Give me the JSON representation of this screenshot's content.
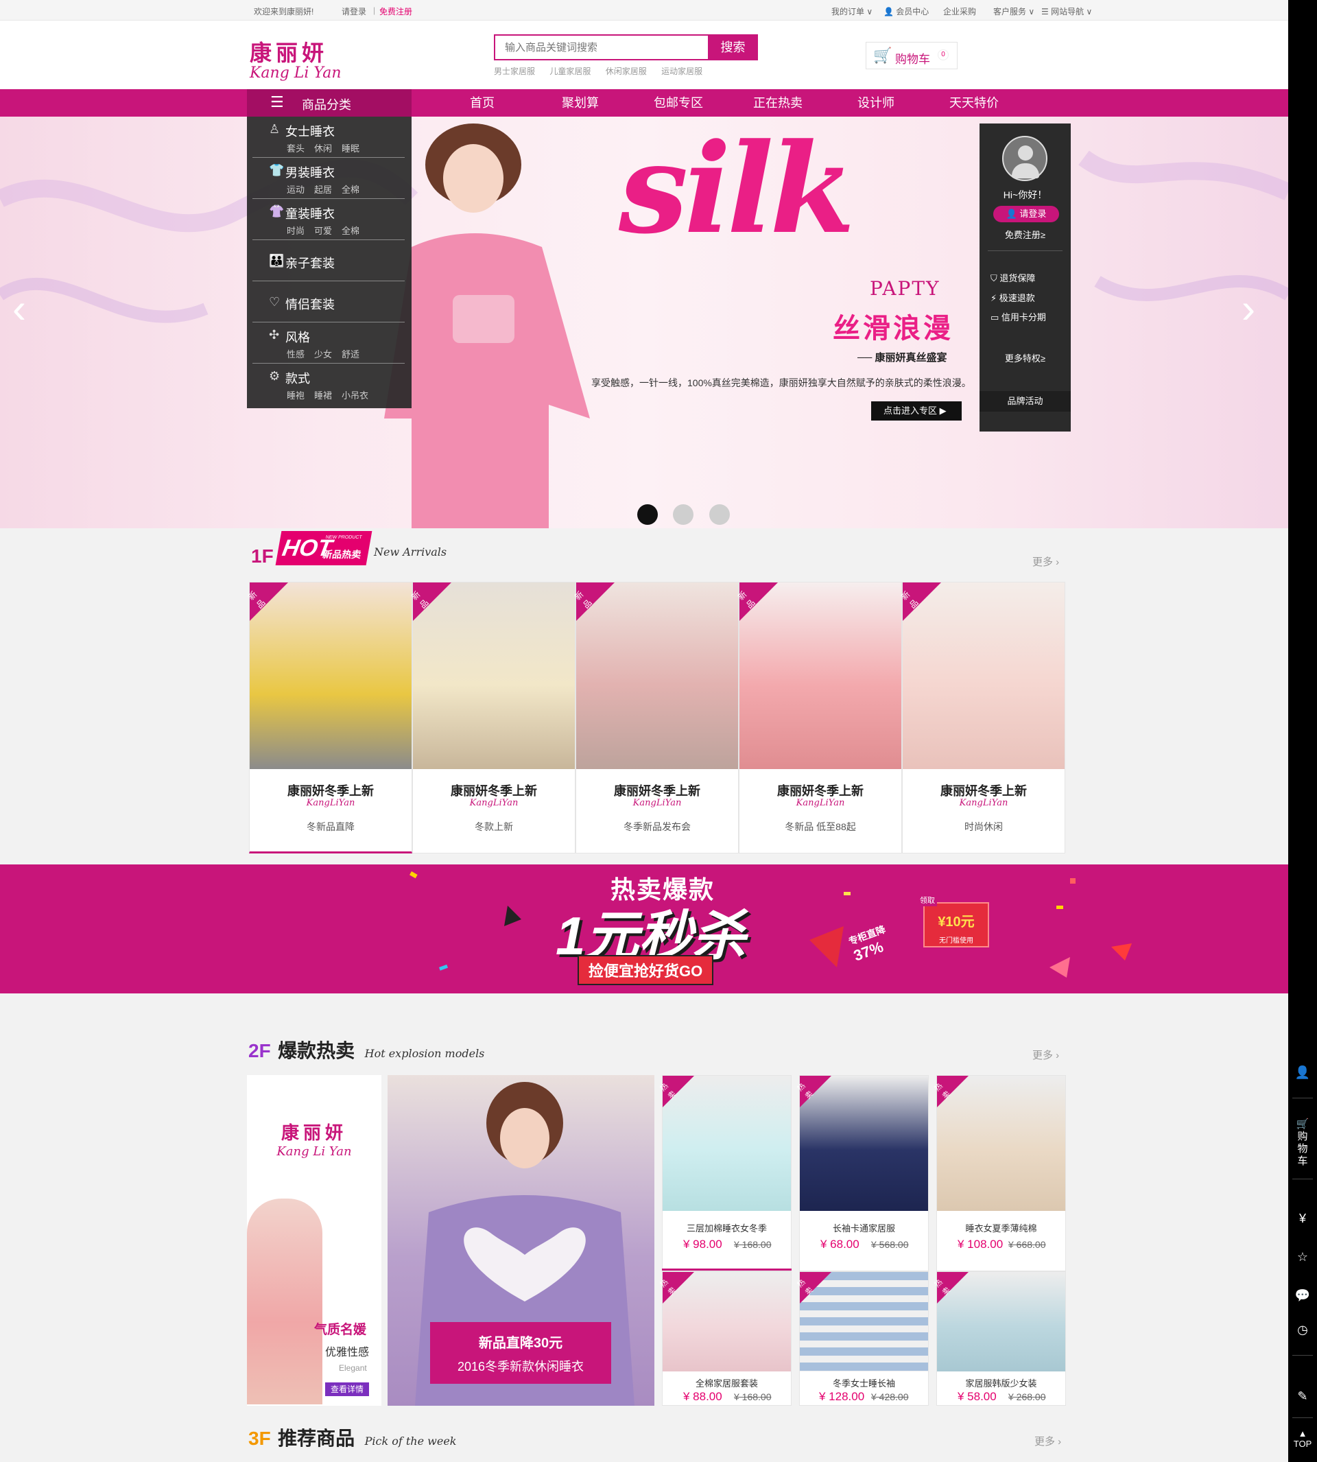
{
  "topbar": {
    "welcome": "欢迎来到康丽妍!",
    "login": "请登录",
    "register": "免费注册",
    "my_orders": "我的订单",
    "member_center": "会员中心",
    "enterprise": "企业采购",
    "customer_service": "客户服务",
    "site_nav": "网站导航"
  },
  "header": {
    "logo_cn": "康丽妍",
    "logo_en": "Kang Li Yan",
    "search_placeholder": "输入商品关键词搜索",
    "search_button": "搜索",
    "hot_words": [
      "男士家居服",
      "儿童家居服",
      "休闲家居服",
      "运动家居服"
    ],
    "cart_label": "购物车",
    "cart_count": "0"
  },
  "nav": {
    "category_label": "商品分类",
    "items": [
      "首页",
      "聚划算",
      "包邮专区",
      "正在热卖",
      "设计师",
      "天天特价"
    ]
  },
  "categories": [
    {
      "title": "女士睡衣",
      "subs": [
        "套头",
        "休闲",
        "睡眠"
      ],
      "icon": "dress-icon"
    },
    {
      "title": "男装睡衣",
      "subs": [
        "运动",
        "起居",
        "全棉"
      ],
      "icon": "shirt-icon"
    },
    {
      "title": "童装睡衣",
      "subs": [
        "时尚",
        "可爱",
        "全棉"
      ],
      "icon": "kids-icon"
    },
    {
      "title": "亲子套装",
      "subs": [],
      "icon": "family-icon"
    },
    {
      "title": "情侣套装",
      "subs": [],
      "icon": "heart-icon"
    },
    {
      "title": "风格",
      "subs": [
        "性感",
        "少女",
        "舒适"
      ],
      "icon": "pinwheel-icon"
    },
    {
      "title": "款式",
      "subs": [
        "睡袍",
        "睡裙",
        "小吊衣"
      ],
      "icon": "gear-icon"
    }
  ],
  "banner": {
    "headline": "silk",
    "party": "PAPTY",
    "cn_headline": "丝滑浪漫",
    "tagline": "康丽妍真丝盛宴",
    "desc": "享受触感，一针一线，100%真丝完美棉造，康丽妍独享大自然赋予的亲肤式的柔性浪漫。",
    "cta": "点击进入专区"
  },
  "userbox": {
    "greeting": "Hi~你好！",
    "login": "请登录",
    "register": "免费注册≥",
    "benefits": [
      "退货保障",
      "极速退款",
      "信用卡分期"
    ],
    "more": "更多特权≥",
    "brand": "品牌活动"
  },
  "floor1": {
    "num": "1F",
    "badge": "HOT",
    "badge_sub": "新品热卖",
    "badge_tiny": "NEW PRODUCT",
    "en": "New Arrivals",
    "more": "更多",
    "tag": "新品",
    "brand": "KangLiYan",
    "products": [
      {
        "title": "康丽妍冬季上新",
        "desc": "冬新品直降",
        "color": "#e9c743"
      },
      {
        "title": "康丽妍冬季上新",
        "desc": "冬款上新",
        "color": "#f2e7c8"
      },
      {
        "title": "康丽妍冬季上新",
        "desc": "冬季新品发布会",
        "color": "#e2b2b0"
      },
      {
        "title": "康丽妍冬季上新",
        "desc": "冬新品  低至88起",
        "color": "#f3a9ad"
      },
      {
        "title": "康丽妍冬季上新",
        "desc": "时尚休闲",
        "color": "#f5d6d0"
      }
    ]
  },
  "promo": {
    "line1": "热卖爆款",
    "big": "1元秒杀",
    "line2": "捡便宜抢好货GO",
    "discount_label": "专柜直降",
    "discount": "37%",
    "coupon_top": "领取",
    "coupon": "¥10元",
    "coupon_sub": "无门槛使用"
  },
  "floor2": {
    "num": "2F",
    "title": "爆款热卖",
    "en": "Hot explosion models",
    "more": "更多",
    "left_logo_cn": "康丽妍",
    "left_logo_en": "Kang Li Yan",
    "left_t1": "气质名媛",
    "left_t2": "优雅性感",
    "left_t3": "Elegant",
    "left_btn": "查看详情",
    "center_t1": "新品直降30元",
    "center_t2": "2016冬季新款休闲睡衣",
    "tag": "热卖",
    "products": [
      {
        "name": "三层加棉睡衣女冬季",
        "price": "¥ 98.00",
        "old": "¥ 168.00",
        "color": "#cfeef0"
      },
      {
        "name": "长袖卡通家居服",
        "price": "¥ 68.00",
        "old": "¥ 568.00",
        "color": "#2a3466"
      },
      {
        "name": "睡衣女夏季薄纯棉",
        "price": "¥ 108.00",
        "old": "¥ 668.00",
        "color": "#ead9c5"
      },
      {
        "name": "全棉家居服套装",
        "price": "¥ 88.00",
        "old": "¥ 168.00",
        "color": "#f2d8dc"
      },
      {
        "name": "冬季女士睡长袖",
        "price": "¥ 128.00",
        "old": "¥ 428.00",
        "color": "#a7bfdc"
      },
      {
        "name": "家居服韩版少女装",
        "price": "¥ 58.00",
        "old": "¥ 268.00",
        "color": "#bcd7df"
      }
    ]
  },
  "floor3": {
    "num": "3F",
    "title": "推荐商品",
    "en": "Pick of the week",
    "more": "更多"
  },
  "sidebar": {
    "cart_label": "购物车",
    "top_label": "TOP"
  },
  "colors": {
    "brand": "#c8157a",
    "price": "#e4006e"
  }
}
